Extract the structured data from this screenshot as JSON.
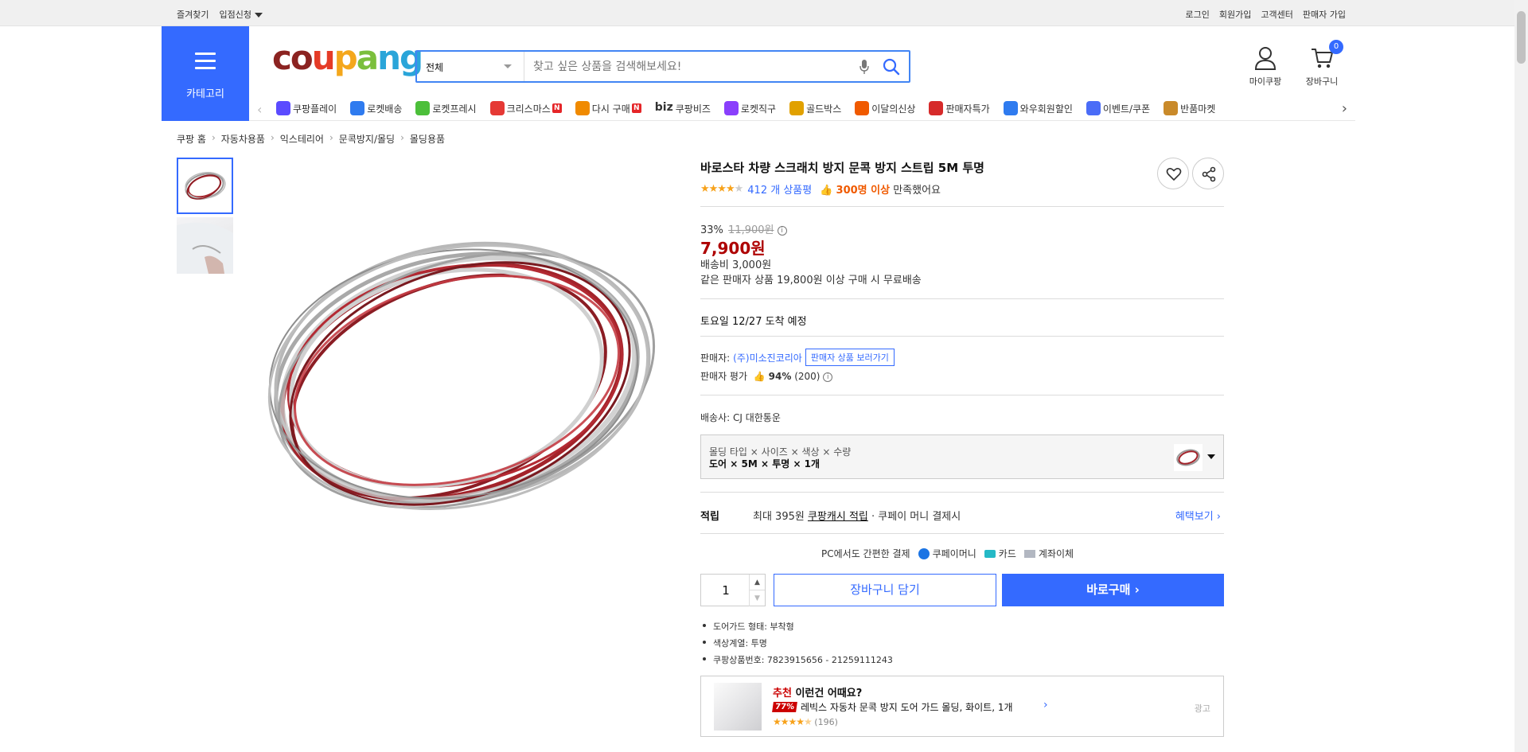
{
  "topbar": {
    "left": [
      "즐겨찾기",
      "입점신청"
    ],
    "right": [
      "로그인",
      "회원가입",
      "고객센터",
      "판매자 가입"
    ]
  },
  "header": {
    "category_label": "카테고리",
    "logo": "coupang",
    "search_scope": "전체",
    "search_placeholder": "찾고 싶은 상품을 검색해보세요!",
    "mypage_label": "마이쿠팡",
    "cart_label": "장바구니",
    "cart_count": "0"
  },
  "nav": [
    {
      "label": "쿠팡플레이",
      "icon": "play-icon",
      "color": "#5b4bff"
    },
    {
      "label": "로켓배송",
      "icon": "rocket-icon",
      "color": "#2f7bef"
    },
    {
      "label": "로켓프레시",
      "icon": "rocket-fresh-icon",
      "color": "#4cbf3a"
    },
    {
      "label": "크리스마스",
      "icon": "santa-icon",
      "color": "#e53935",
      "badge": "N"
    },
    {
      "label": "다시 구매",
      "icon": "home-icon",
      "color": "#f08a00",
      "badge": "N"
    },
    {
      "label": "쿠팡비즈",
      "icon": "biz-icon",
      "color": "#333333",
      "prefix": "biz"
    },
    {
      "label": "로켓직구",
      "icon": "globe-icon",
      "color": "#8a3ffc"
    },
    {
      "label": "골드박스",
      "icon": "goldbox-icon",
      "color": "#e1a100"
    },
    {
      "label": "이달의신상",
      "icon": "shopping-bag-icon",
      "color": "#f05a00"
    },
    {
      "label": "판매자특가",
      "icon": "percent-icon",
      "color": "#d62a2a"
    },
    {
      "label": "와우회원할인",
      "icon": "wow-icon",
      "color": "#2f7bef"
    },
    {
      "label": "이벤트/쿠폰",
      "icon": "coupon-icon",
      "color": "#4a6cf7"
    },
    {
      "label": "반품마켓",
      "icon": "return-market-icon",
      "color": "#c98a2a"
    }
  ],
  "breadcrumb": [
    "쿠팡 홈",
    "자동차용품",
    "익스테리어",
    "문콕방지/몰딩",
    "몰딩용품"
  ],
  "product": {
    "title": "바로스타 차량 스크래치 방지 문콕 방지 스트립 5M 투명",
    "rating_count": "412 개 상품평",
    "satisfaction_strong": "300명 이상",
    "satisfaction_rest": " 만족했어요",
    "discount_rate": "33%",
    "original_price": "11,900원",
    "price": "7,900원",
    "shipping_fee": "배송비 3,000원",
    "free_shipping": "같은 판매자 상품 19,800원 이상 구매 시 무료배송",
    "arrival": "토요일 12/27 도착 예정",
    "seller_label": "판매자:",
    "seller_name": "(주)미소진코리아",
    "seller_link": "판매자 상품 보러가기",
    "seller_rating_label": "판매자 평가",
    "seller_rating_pct": "94%",
    "seller_rating_count": "(200)",
    "carrier": "배송사:  CJ 대한통운",
    "option_label": "몰딩 타입 × 사이즈 × 색상 × 수량",
    "option_value": "도어 × 5M × 투명 × 1개",
    "reward_label": "적립",
    "reward_prefix": "최대 395원 ",
    "reward_link": "쿠팡캐시 적립",
    "reward_suffix": " · 쿠페이 머니 결제시",
    "reward_more": "혜택보기 ›",
    "pay_title": "PC에서도 간편한 결제",
    "pay_methods": [
      "쿠페이머니",
      "카드",
      "계좌이체"
    ],
    "quantity": "1",
    "cart_button": "장바구니 담기",
    "buy_button": "바로구매 ›",
    "attributes": [
      "도어가드 형태: 부착형",
      "색상계열: 투명",
      "쿠팡상품번호: 7823915656 - 21259111243"
    ]
  },
  "recommendation": {
    "head_strong": "추천",
    "head_rest": " 이런건 어때요?",
    "discount": "77%",
    "name": "레빅스 자동차 문콕 방지 도어 가드 몰딩, 화이트, 1개",
    "reviews": "(196)",
    "ad_label": "광고"
  }
}
